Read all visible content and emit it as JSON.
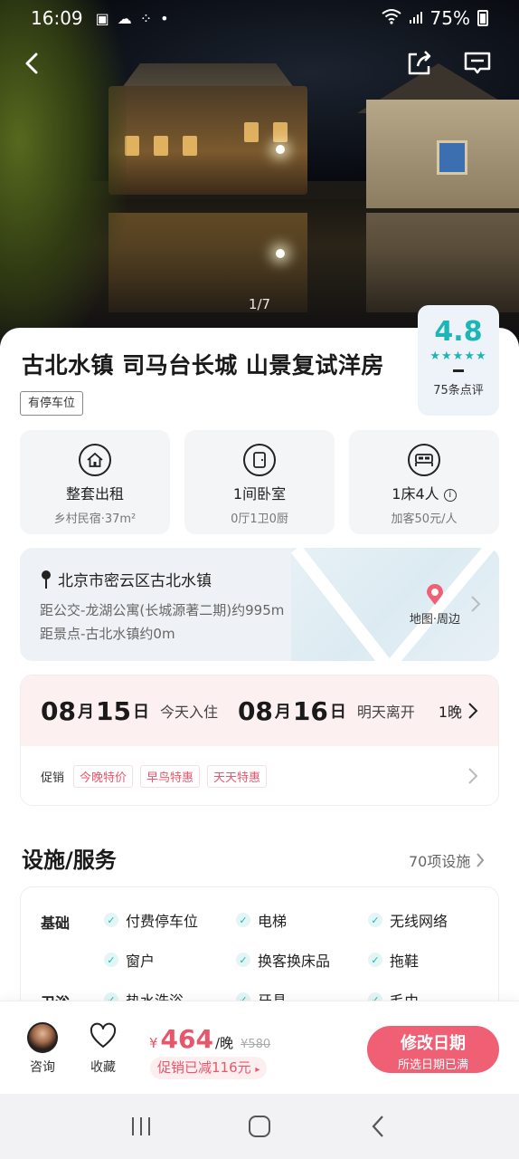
{
  "status_bar": {
    "time": "16:09",
    "battery": "75%"
  },
  "hero": {
    "photo_counter": "1/7"
  },
  "listing": {
    "title": "古北水镇 司马台长城 山景复试洋房",
    "tag": "有停车位",
    "rating": {
      "score": "4.8",
      "stars": "★★★★★",
      "review_count": "75条点评"
    }
  },
  "features": [
    {
      "icon": "house-icon",
      "main": "整套出租",
      "sub": "乡村民宿·37m²"
    },
    {
      "icon": "door-icon",
      "main": "1间卧室",
      "sub": "0厅1卫0厨"
    },
    {
      "icon": "bed-icon",
      "main": "1床4人",
      "sub": "加客50元/人"
    }
  ],
  "location": {
    "address": "北京市密云区古北水镇",
    "distance_1": "距公交-龙湖公寓(长城源著二期)约995m",
    "distance_2": "距景点-古北水镇约0m",
    "map_link": "地图·周边"
  },
  "dates": {
    "checkin_month": "08",
    "checkin_day": "15",
    "checkin_label": "今天入住",
    "checkout_month": "08",
    "checkout_day": "16",
    "checkout_label": "明天离开",
    "month_unit": "月",
    "day_unit": "日",
    "nights": "1晚"
  },
  "promotion": {
    "label": "促销",
    "tags": [
      "今晚特价",
      "早鸟特惠",
      "天天特惠"
    ]
  },
  "facilities": {
    "heading": "设施/服务",
    "more": "70项设施",
    "categories": [
      {
        "name": "基础",
        "items": [
          "付费停车位",
          "电梯",
          "无线网络",
          "窗户",
          "换客换床品",
          "拖鞋"
        ]
      },
      {
        "name": "卫浴",
        "items": [
          "热水洗浴",
          "牙具",
          "毛巾"
        ]
      }
    ]
  },
  "action_bar": {
    "consult": "咨询",
    "favorite": "收藏",
    "currency": "¥",
    "price": "464",
    "per_night": "/晚",
    "original_price": "¥580",
    "discount": "促销已减116元",
    "cta_title": "修改日期",
    "cta_sub": "所选日期已满"
  },
  "colors": {
    "accent": "#e8566b",
    "rating": "#1db6b6",
    "cta": "#ef6075"
  }
}
